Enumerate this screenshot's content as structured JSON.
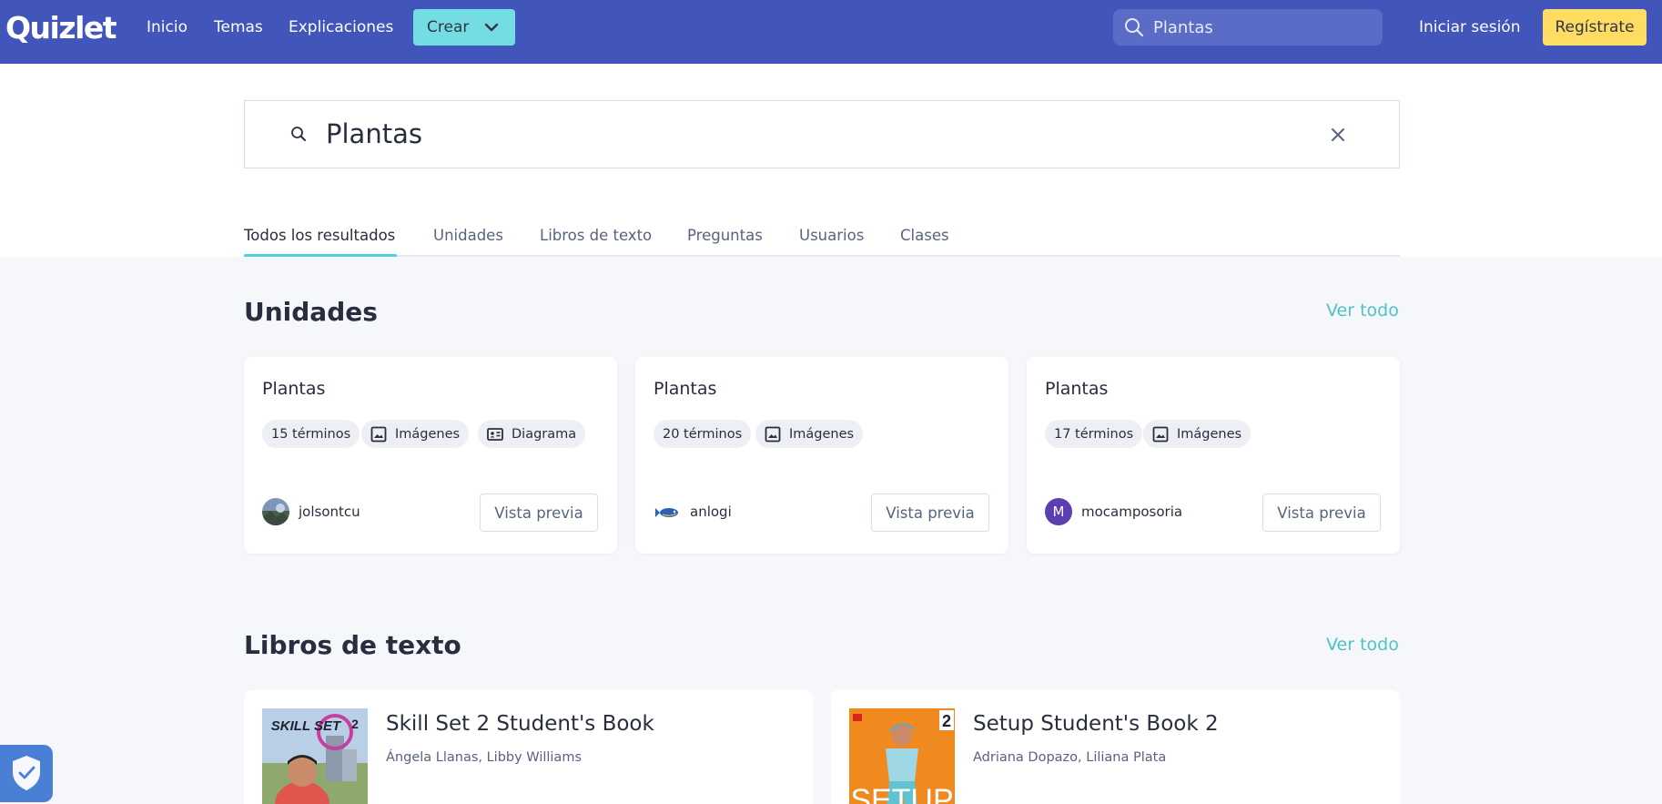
{
  "header": {
    "logo": "Quizlet",
    "nav": [
      "Inicio",
      "Temas",
      "Explicaciones"
    ],
    "create_label": "Crear",
    "search_value": "Plantas",
    "login_label": "Iniciar sesión",
    "signup_label": "Regístrate"
  },
  "search": {
    "value": "Plantas"
  },
  "tabs": [
    "Todos los resultados",
    "Unidades",
    "Libros de texto",
    "Preguntas",
    "Usuarios",
    "Clases"
  ],
  "units": {
    "title": "Unidades",
    "see_all": "Ver todo",
    "cards": [
      {
        "title": "Plantas",
        "terms": "15 términos",
        "chips": [
          "Imágenes",
          "Diagrama"
        ],
        "user": "jolsontcu",
        "preview": "Vista previa"
      },
      {
        "title": "Plantas",
        "terms": "20 términos",
        "chips": [
          "Imágenes"
        ],
        "user": "anlogi",
        "preview": "Vista previa"
      },
      {
        "title": "Plantas",
        "terms": "17 términos",
        "chips": [
          "Imágenes"
        ],
        "user": "mocamposoria",
        "avatar_letter": "M",
        "preview": "Vista previa"
      }
    ]
  },
  "textbooks": {
    "title": "Libros de texto",
    "see_all": "Ver todo",
    "books": [
      {
        "title": "Skill Set 2 Student's Book",
        "authors": "Ángela Llanas, Libby Williams",
        "cover_text": "SKILL SET",
        "cover_num": "2"
      },
      {
        "title": "Setup Student's Book 2",
        "authors": "Adriana Dopazo, Liliana Plata",
        "cover_text": "SETUP",
        "cover_num": "2"
      }
    ]
  },
  "colors": {
    "header": "#4255ba",
    "accent": "#4dc2c9",
    "signup": "#ffdc62",
    "create": "#74dde3"
  }
}
